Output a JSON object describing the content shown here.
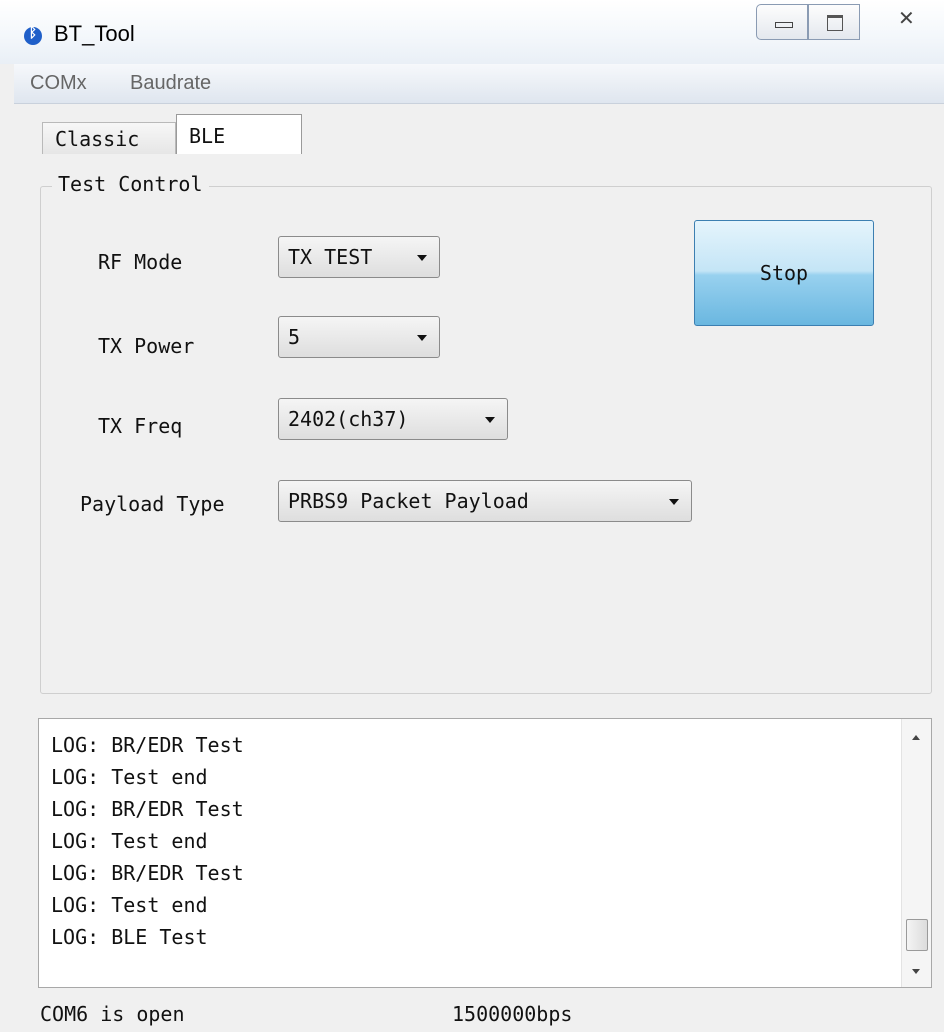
{
  "window": {
    "title": "BT_Tool",
    "accent": "#1f5fc9"
  },
  "menu": {
    "items": [
      "COMx",
      "Baudrate"
    ]
  },
  "tabs": [
    {
      "label": "Classic",
      "active": false
    },
    {
      "label": "BLE",
      "active": true
    }
  ],
  "test_control": {
    "title": "Test Control",
    "rf_mode": {
      "label": "RF Mode",
      "value": "TX TEST"
    },
    "tx_power": {
      "label": "TX Power",
      "value": "5"
    },
    "tx_freq": {
      "label": "TX Freq",
      "value": "2402(ch37)"
    },
    "payload_type": {
      "label": "Payload Type",
      "value": "PRBS9 Packet Payload"
    },
    "stop_button": "Stop"
  },
  "log": {
    "lines": [
      "LOG: BR/EDR Test",
      "LOG: Test end",
      "LOG: BR/EDR Test",
      "LOG: Test end",
      "LOG: BR/EDR Test",
      "LOG: Test end",
      "LOG: BLE Test"
    ]
  },
  "status": {
    "port": "COM6 is open",
    "baudrate": "1500000bps"
  }
}
